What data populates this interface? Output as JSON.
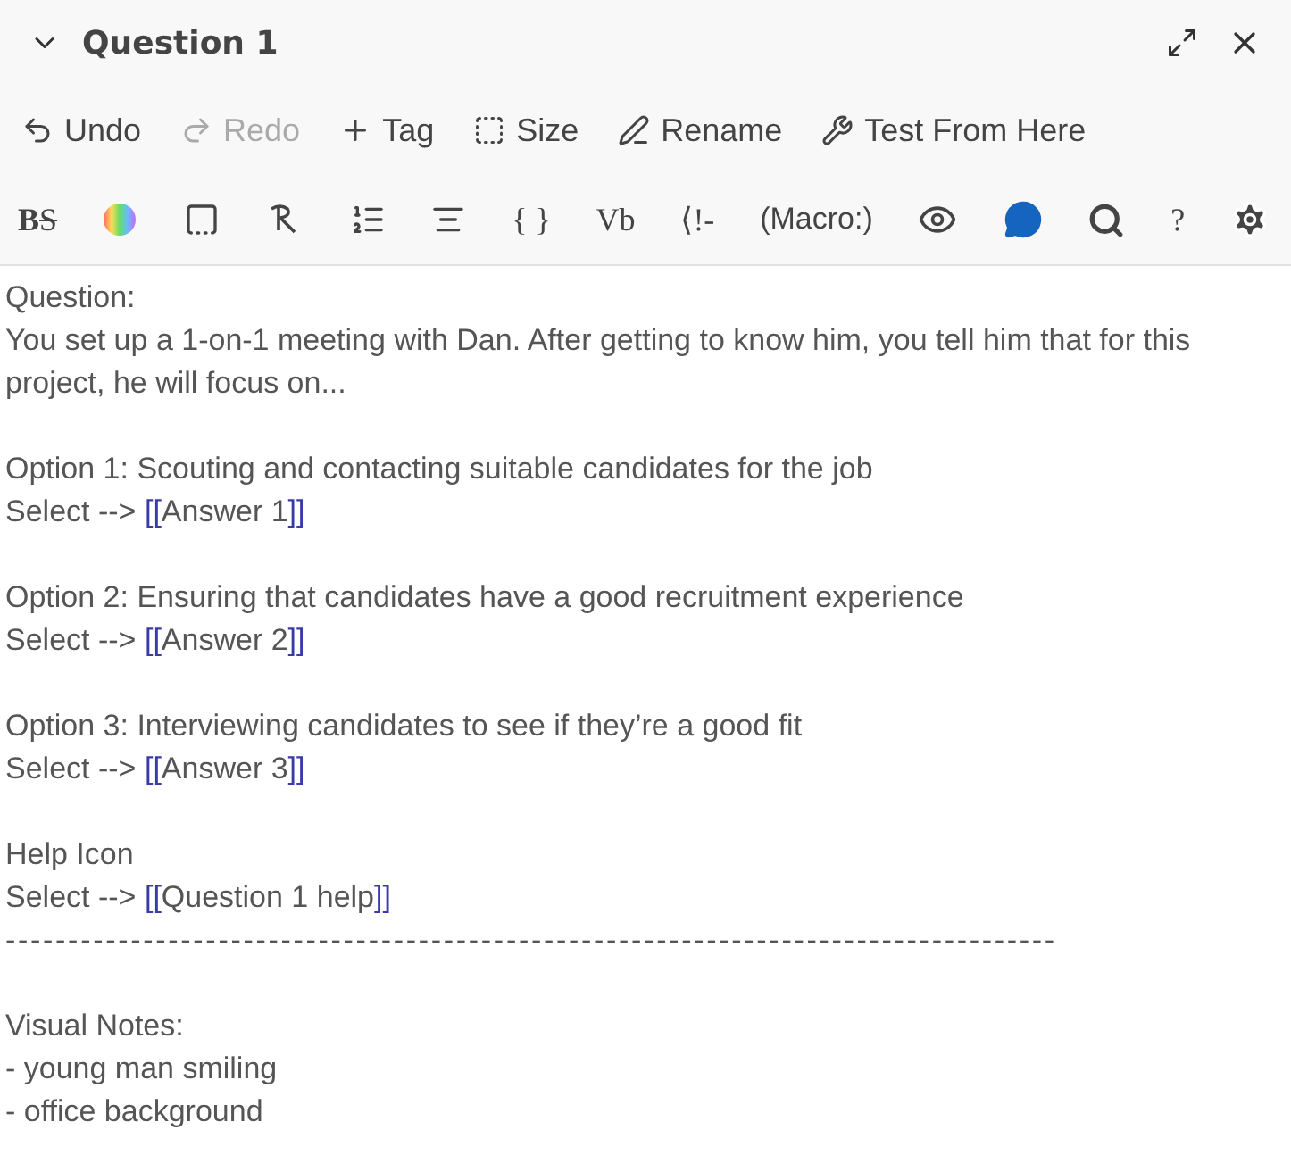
{
  "dialog": {
    "title": "Question 1",
    "expanded": true
  },
  "toolbar": [
    {
      "label": "Undo",
      "disabled": false
    },
    {
      "label": "Redo",
      "disabled": true
    },
    {
      "label": "Tag",
      "disabled": false
    },
    {
      "label": "Size",
      "disabled": false
    },
    {
      "label": "Rename",
      "disabled": false
    },
    {
      "label": "Test From Here",
      "disabled": false
    }
  ],
  "format_toolbar": [
    {
      "kind": "strike",
      "label": "BS"
    },
    {
      "kind": "icon"
    },
    {
      "kind": "icon"
    },
    {
      "kind": "icon"
    },
    {
      "kind": "icon"
    },
    {
      "kind": "icon"
    },
    {
      "kind": "glyph",
      "label": "{ }"
    },
    {
      "kind": "glyph",
      "label": "Vb"
    },
    {
      "kind": "glyph",
      "label": "⟨!-"
    },
    {
      "kind": "glyph",
      "label": "(Macro:)"
    },
    {
      "kind": "icon"
    },
    {
      "kind": "icon"
    },
    {
      "kind": "icon"
    },
    {
      "kind": "glyph",
      "label": "?"
    },
    {
      "kind": "icon"
    }
  ],
  "paragraphs": [
    [
      {
        "text": "Question:"
      },
      {
        "text": "You set up a 1-on-1 meeting with Dan. After getting to know him, you tell him that for this project, he will focus on..."
      }
    ],
    [
      {
        "text": "Option 1: Scouting and contacting suitable candidates for the job"
      },
      {
        "text": "Select -->",
        "link": "[[Answer 1]]"
      }
    ],
    [
      {
        "text": "Option 2: Ensuring that candidates have a good recruitment experience"
      },
      {
        "text": "Select -->",
        "link": "[[Answer 2]]"
      }
    ],
    [
      {
        "text": "Option 3: Interviewing candidates to see if they’re a good fit"
      },
      {
        "text": "Select -->",
        "link": "[[Answer 3]]"
      }
    ],
    [
      {
        "text": "Help Icon"
      },
      {
        "text": "Select -->",
        "link": "[[Question 1 help]]"
      },
      {
        "kind": "rule",
        "text": "------------------------------------------------------------------------------------"
      }
    ],
    [
      {
        "text": "Visual Notes:"
      },
      {
        "text": "- young man smiling"
      },
      {
        "text": "- office background"
      }
    ]
  ]
}
